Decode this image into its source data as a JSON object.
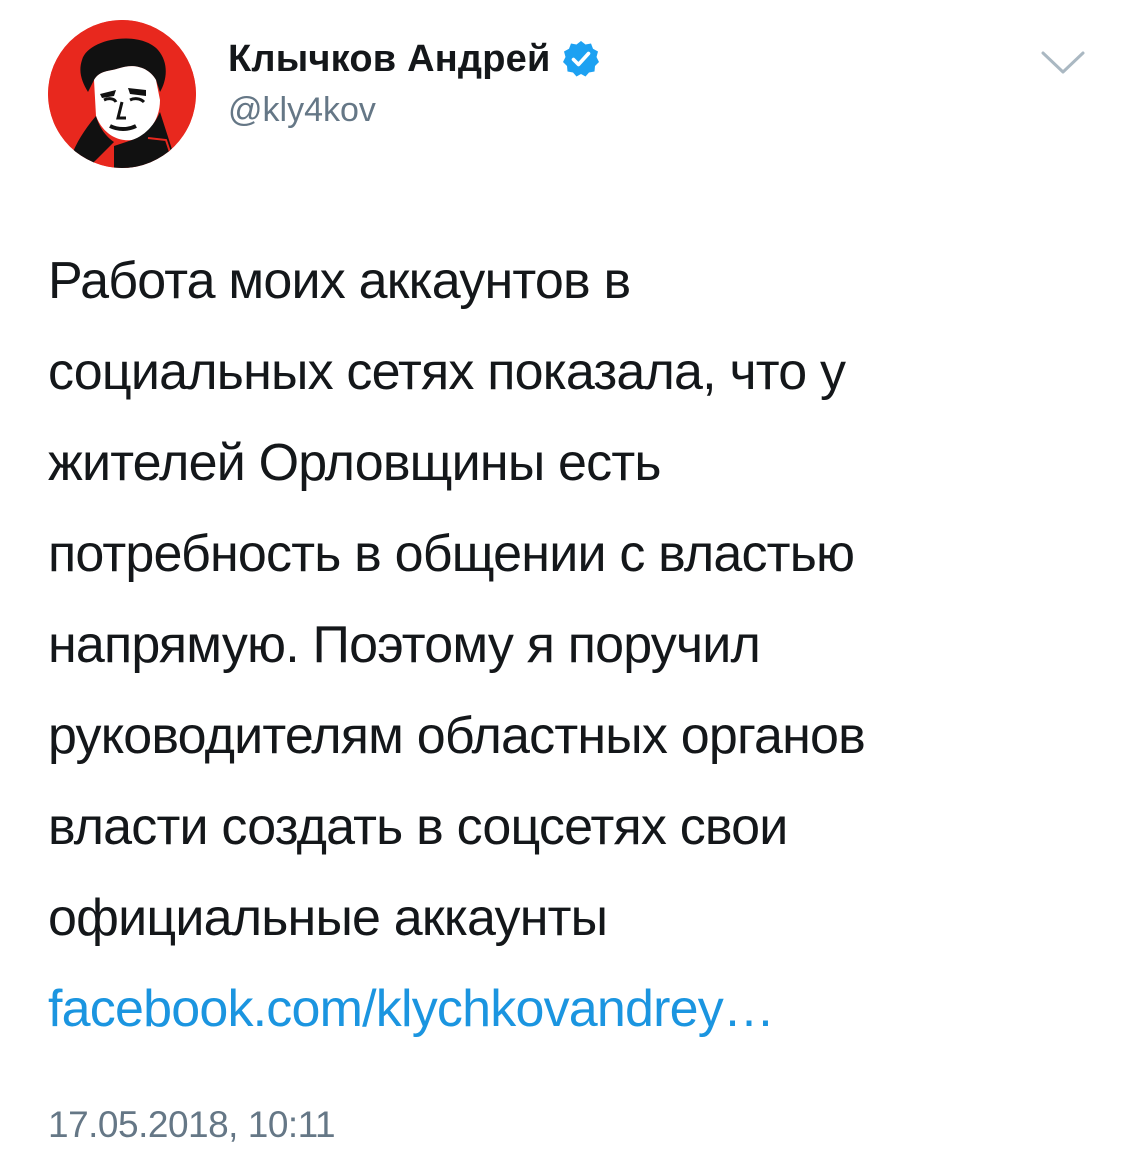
{
  "author": {
    "display_name": "Клычков Андрей",
    "handle": "@kly4kov",
    "verified": true,
    "avatar_icon": "portrait-avatar-icon",
    "avatar_color": "#e8281e"
  },
  "header": {
    "caret_icon": "chevron-down-icon"
  },
  "tweet": {
    "lines": [
      "Работа моих аккаунтов в",
      "социальных сетях показала, что у",
      "жителей Орловщины есть",
      "потребность в общении с властью",
      "напрямую. Поэтому я поручил",
      "руководителям областных органов",
      "власти создать в соцсетях свои",
      "официальные аккаунты"
    ],
    "link_text": "facebook.com/klychkovandrey…",
    "timestamp": "17.05.2018, 10:11"
  },
  "colors": {
    "text": "#14171a",
    "secondary": "#657786",
    "link": "#1b95e0",
    "verified": "#1da1f2",
    "caret": "#aab8c2"
  }
}
